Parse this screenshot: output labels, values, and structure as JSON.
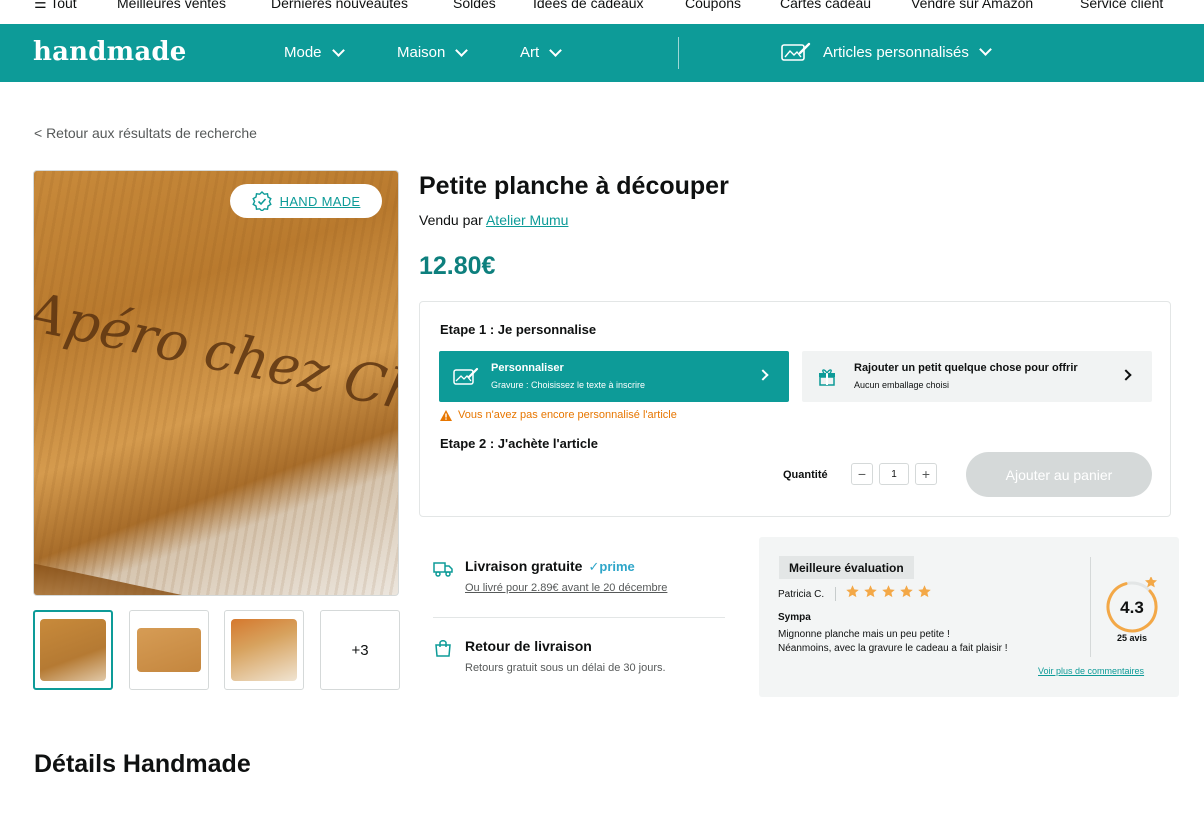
{
  "topnav": {
    "items": [
      "☰ Tout",
      "Meilleures ventes",
      "Dernières nouveautés",
      "Soldes",
      "Idées de cadeaux",
      "Coupons",
      "Cartes cadeau",
      "Vendre sur Amazon",
      "Service client"
    ]
  },
  "header": {
    "logo": "handmade",
    "nav": [
      "Mode",
      "Maison",
      "Art"
    ],
    "personalized": "Articles personnalisés"
  },
  "back_link": "< Retour aux résultats de recherche",
  "gallery": {
    "badge": "HAND MADE",
    "more_count": "+3",
    "engraving": "Apéro chez Ch"
  },
  "product": {
    "title": "Petite planche à découper",
    "sold_by_label": "Vendu par",
    "seller": "Atelier Mumu",
    "price": "12.80€"
  },
  "personalization": {
    "step1": "Etape 1 : Je personnalise",
    "personalize_title": "Personnaliser",
    "personalize_sub": "Gravure : Choisissez le texte à inscrire",
    "gift_title": "Rajouter un petit quelque chose pour offrir",
    "gift_sub": "Aucun emballage choisi",
    "warning": "Vous n'avez pas encore personnalisé l'article",
    "step2": "Etape 2 : J'achète l'article",
    "qty_label": "Quantité",
    "qty_value": "1",
    "add_to_cart": "Ajouter au panier"
  },
  "shipping": {
    "free_title": "Livraison gratuite",
    "prime": "prime",
    "free_sub": "Ou livré pour 2.89€ avant le 20 décembre",
    "return_title": "Retour de livraison",
    "return_sub": "Retours gratuit sous un délai de 30 jours."
  },
  "review": {
    "tag": "Meilleure évaluation",
    "author": "Patricia C.",
    "stars": 5,
    "headline": "Sympa",
    "body_line1": "Mignonne planche mais un peu petite !",
    "body_line2": "Néanmoins, avec la gravure le cadeau a fait plaisir !",
    "more_link": "Voir plus de commentaires",
    "score": "4.3",
    "count": "25 avis"
  },
  "section_title": "Détails Handmade",
  "colors": {
    "brand": "#0d9b98",
    "price": "#0d7f7d",
    "warning": "#e77600",
    "star": "#f3a847",
    "prime": "#2fa6c9"
  }
}
